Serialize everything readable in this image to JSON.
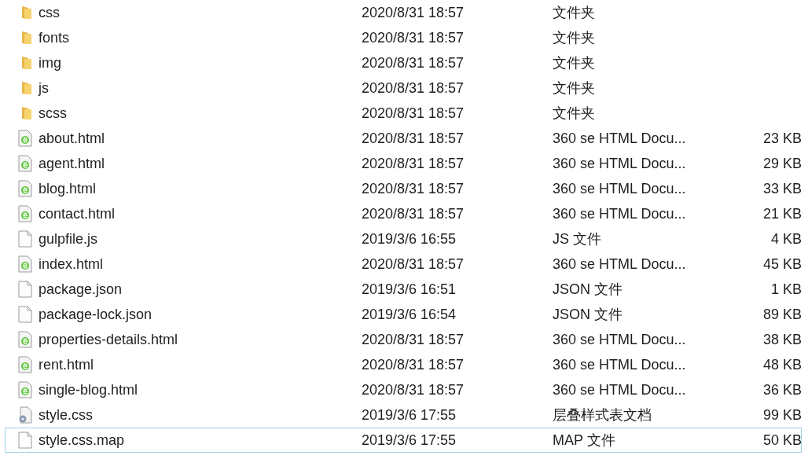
{
  "files": [
    {
      "kind": "folder",
      "name": "css",
      "modified": "2020/8/31 18:57",
      "type": "文件夹",
      "focused": false
    },
    {
      "kind": "folder",
      "name": "fonts",
      "modified": "2020/8/31 18:57",
      "type": "文件夹",
      "focused": false
    },
    {
      "kind": "folder",
      "name": "img",
      "modified": "2020/8/31 18:57",
      "type": "文件夹",
      "focused": false
    },
    {
      "kind": "folder",
      "name": "js",
      "modified": "2020/8/31 18:57",
      "type": "文件夹",
      "focused": false
    },
    {
      "kind": "folder",
      "name": "scss",
      "modified": "2020/8/31 18:57",
      "type": "文件夹",
      "focused": false
    },
    {
      "kind": "html",
      "name": "about.html",
      "modified": "2020/8/31 18:57",
      "type": "360 se HTML Docu...",
      "size": "23 KB",
      "focused": false
    },
    {
      "kind": "html",
      "name": "agent.html",
      "modified": "2020/8/31 18:57",
      "type": "360 se HTML Docu...",
      "size": "29 KB",
      "focused": false
    },
    {
      "kind": "html",
      "name": "blog.html",
      "modified": "2020/8/31 18:57",
      "type": "360 se HTML Docu...",
      "size": "33 KB",
      "focused": false
    },
    {
      "kind": "html",
      "name": "contact.html",
      "modified": "2020/8/31 18:57",
      "type": "360 se HTML Docu...",
      "size": "21 KB",
      "focused": false
    },
    {
      "kind": "file",
      "name": "gulpfile.js",
      "modified": "2019/3/6 16:55",
      "type": "JS 文件",
      "size": "4 KB",
      "focused": false
    },
    {
      "kind": "html",
      "name": "index.html",
      "modified": "2020/8/31 18:57",
      "type": "360 se HTML Docu...",
      "size": "45 KB",
      "focused": false
    },
    {
      "kind": "file",
      "name": "package.json",
      "modified": "2019/3/6 16:51",
      "type": "JSON 文件",
      "size": "1 KB",
      "focused": false
    },
    {
      "kind": "file",
      "name": "package-lock.json",
      "modified": "2019/3/6 16:54",
      "type": "JSON 文件",
      "size": "89 KB",
      "focused": false
    },
    {
      "kind": "html",
      "name": "properties-details.html",
      "modified": "2020/8/31 18:57",
      "type": "360 se HTML Docu...",
      "size": "38 KB",
      "focused": false
    },
    {
      "kind": "html",
      "name": "rent.html",
      "modified": "2020/8/31 18:57",
      "type": "360 se HTML Docu...",
      "size": "48 KB",
      "focused": false
    },
    {
      "kind": "html",
      "name": "single-blog.html",
      "modified": "2020/8/31 18:57",
      "type": "360 se HTML Docu...",
      "size": "36 KB",
      "focused": false
    },
    {
      "kind": "css",
      "name": "style.css",
      "modified": "2019/3/6 17:55",
      "type": "层叠样式表文档",
      "size": "99 KB",
      "focused": false
    },
    {
      "kind": "file",
      "name": "style.css.map",
      "modified": "2019/3/6 17:55",
      "type": "MAP 文件",
      "size": "50 KB",
      "focused": true
    }
  ]
}
